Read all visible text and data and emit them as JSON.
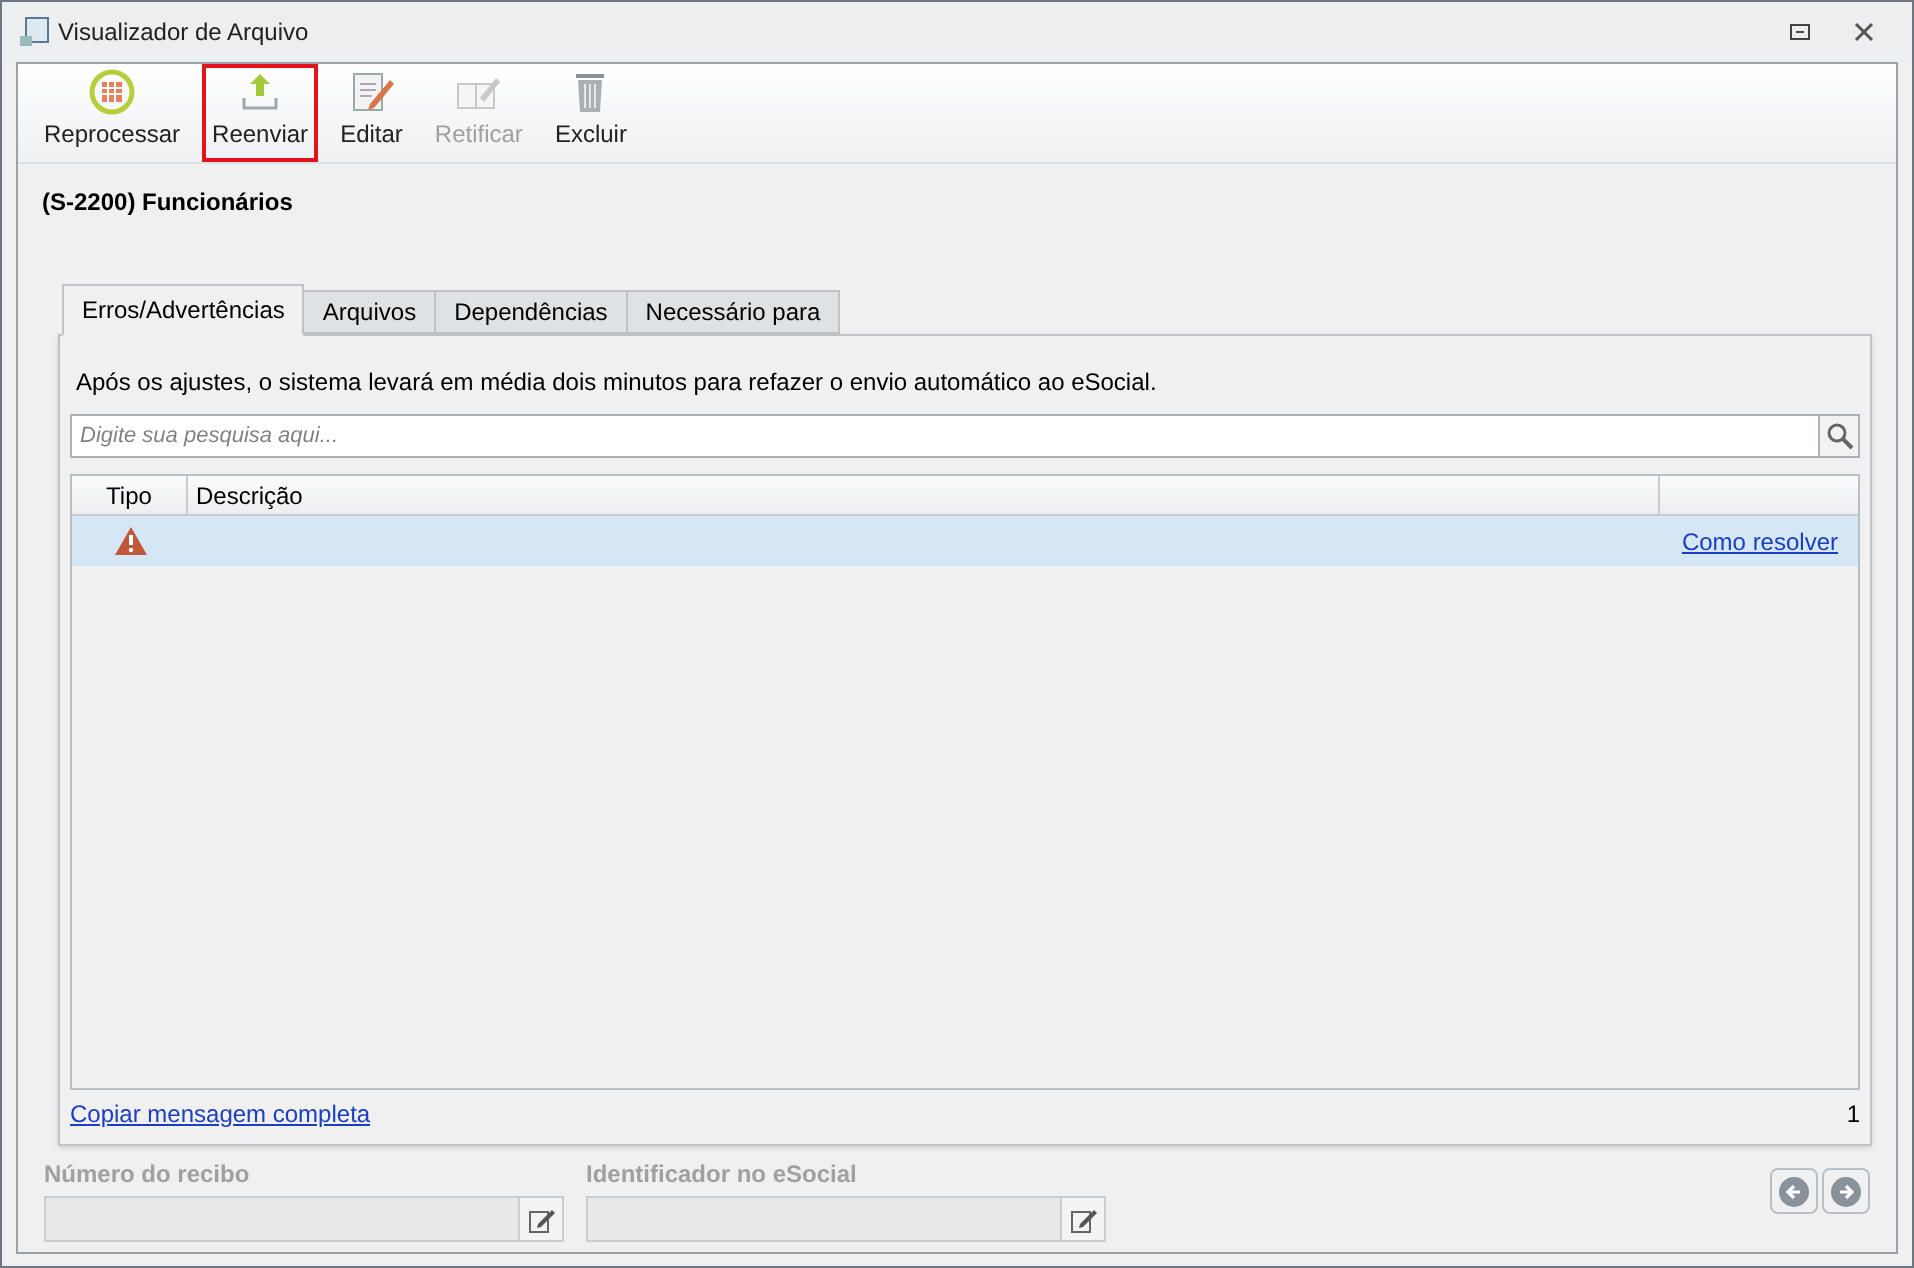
{
  "window": {
    "title": "Visualizador de Arquivo"
  },
  "toolbar": [
    {
      "label": "Reprocessar",
      "kind": "reprocess",
      "disabled": false,
      "highlighted": false
    },
    {
      "label": "Reenviar",
      "kind": "upload",
      "disabled": false,
      "highlighted": true
    },
    {
      "label": "Editar",
      "kind": "edit",
      "disabled": false,
      "highlighted": false
    },
    {
      "label": "Retificar",
      "kind": "rectify",
      "disabled": true,
      "highlighted": false
    },
    {
      "label": "Excluir",
      "kind": "delete",
      "disabled": false,
      "highlighted": false
    }
  ],
  "heading": "(S-2200) Funcionários",
  "tabs": [
    {
      "label": "Erros/Advertências",
      "selected": true
    },
    {
      "label": "Arquivos",
      "selected": false
    },
    {
      "label": "Dependências",
      "selected": false
    },
    {
      "label": "Necessário para",
      "selected": false
    }
  ],
  "notice": "Após os ajustes, o sistema levará em média dois minutos para refazer o envio automático ao eSocial.",
  "search": {
    "placeholder": "Digite sua pesquisa aqui..."
  },
  "table": {
    "columns": [
      "Tipo",
      "Descrição"
    ],
    "rows": [
      {
        "kind": "warning",
        "link": "Como resolver",
        "selected": true
      }
    ]
  },
  "copy_link": "Copiar mensagem completa",
  "count": "1",
  "fields": [
    {
      "label": "Número do recibo",
      "disabled": true
    },
    {
      "label": "Identificador no eSocial",
      "disabled": true
    }
  ]
}
